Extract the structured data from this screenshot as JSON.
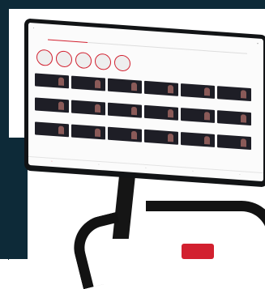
{
  "scene": {
    "description_colors": {
      "navy": "#0d2a38",
      "peloton_red": "#d2202f",
      "screen_bg": "#fbfbfb",
      "frame_black": "#121416"
    }
  },
  "screen": {
    "title": "",
    "tabs": [],
    "icons": {
      "status": "status-icons",
      "nav": "bottom-nav-icons"
    }
  }
}
